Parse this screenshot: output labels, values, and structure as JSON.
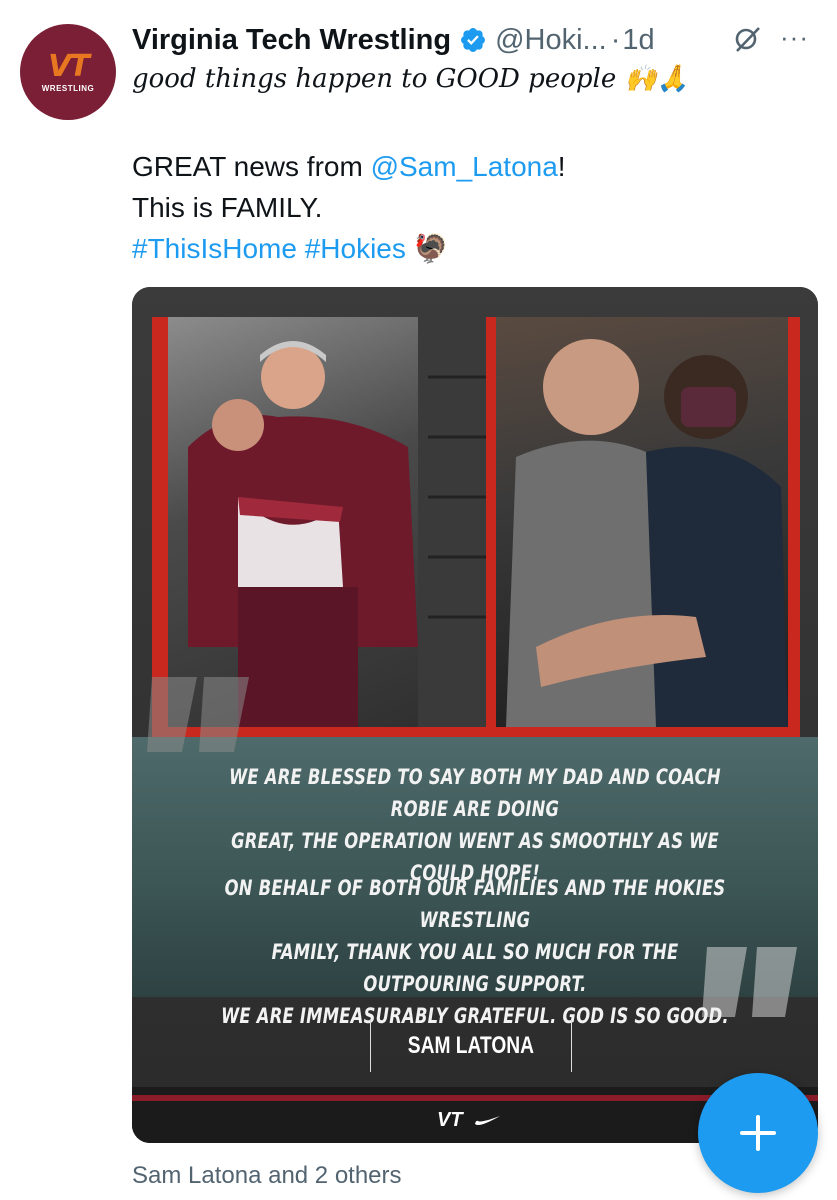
{
  "account": {
    "avatar_text": "VT",
    "avatar_subtext": "WRESTLING",
    "display_name": "Virginia Tech Wrestling",
    "handle": "@Hoki...",
    "separator": "·",
    "timestamp": "1d",
    "more_label": "···"
  },
  "tweet": {
    "tagline": "good things happen to GOOD people 🙌🙏",
    "line1_prefix": "GREAT news from ",
    "mention": "@Sam_Latona",
    "line1_suffix": "!",
    "line2": "This is FAMILY.",
    "hashtag1": "#ThisIsHome",
    "hashtag2": "#Hokies",
    "emoji": "🦃"
  },
  "graphic": {
    "quote_paragraph1_line1": "WE ARE BLESSED TO SAY BOTH MY DAD AND COACH ROBIE ARE DOING",
    "quote_paragraph1_line2": "GREAT, THE OPERATION WENT AS SMOOTHLY AS WE COULD HOPE!",
    "quote_paragraph2_line1": "ON BEHALF OF BOTH OUR FAMILIES AND THE HOKIES WRESTLING",
    "quote_paragraph2_line2": "FAMILY, THANK YOU ALL SO MUCH FOR THE OUTPOURING SUPPORT.",
    "quote_paragraph2_line3": "WE ARE IMMEASURABLY GRATEFUL. GOD IS SO GOOD.",
    "signature": "SAM LATONA",
    "footer_logo": "VT"
  },
  "footer": {
    "likes_text": "Sam Latona and 2 others"
  },
  "fab": {
    "label": "+"
  },
  "colors": {
    "link": "#1d9bf0",
    "avatar_bg": "#7a1f35",
    "vt_orange": "#e87722",
    "fab": "#1d9bf0"
  }
}
